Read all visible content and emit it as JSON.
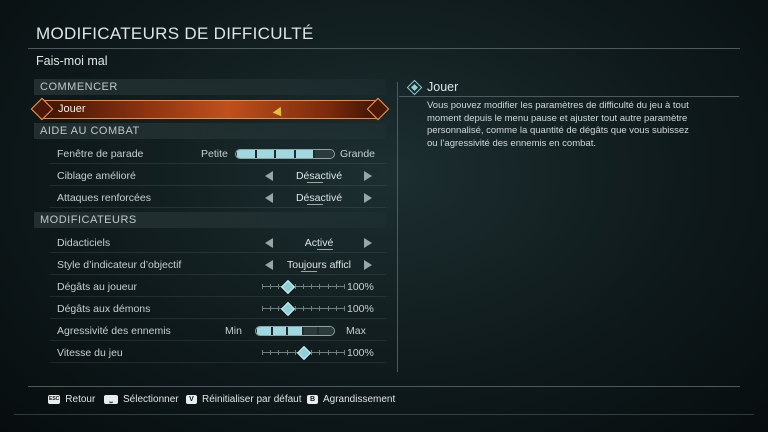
{
  "header": {
    "title": "MODIFICATEURS DE DIFFICULTÉ",
    "subtitle": "Fais-moi mal"
  },
  "sections": {
    "start": "COMMENCER",
    "combat": "AIDE AU COMBAT",
    "modifiers": "MODIFICATEURS"
  },
  "play": {
    "label": "Jouer"
  },
  "rows": {
    "parry": {
      "label": "Fenêtre de parade",
      "min": "Petite",
      "max": "Grande",
      "level": 0.8
    },
    "aim": {
      "label": "Ciblage amélioré",
      "value": "Désactivé"
    },
    "attacks": {
      "label": "Attaques renforcées",
      "value": "Désactivé"
    },
    "tutorials": {
      "label": "Didacticiels",
      "value": "Activé"
    },
    "objective": {
      "label": "Style d’indicateur d’objectif",
      "value": "Toujours afficl"
    },
    "dmg_player": {
      "label": "Dégâts au joueur",
      "value": "100%",
      "level": 0.3
    },
    "dmg_demons": {
      "label": "Dégâts aux démons",
      "value": "100%",
      "level": 0.3
    },
    "aggro": {
      "label": "Agressivité des ennemis",
      "min": "Min",
      "max": "Max",
      "level": 0.5
    },
    "speed": {
      "label": "Vitesse du jeu",
      "value": "100%",
      "level": 0.5
    }
  },
  "description": {
    "title": "Jouer",
    "body": "Vous pouvez modifier les paramètres de difficulté du jeu à tout moment depuis le menu pause et ajuster tout autre paramètre personnalisé, comme la quantité de dégâts que vous subissez ou l’agressivité des ennemis en combat."
  },
  "footer": {
    "back": {
      "key": "ESC",
      "label": "Retour"
    },
    "select": {
      "key": "⎵",
      "label": "Sélectionner"
    },
    "reset": {
      "key": "V",
      "label": "Réinitialiser par défaut"
    },
    "zoom": {
      "key": "B",
      "label": "Agrandissement"
    }
  },
  "colors": {
    "accent": "#8fd0d6",
    "highlight": "#c0501c"
  }
}
